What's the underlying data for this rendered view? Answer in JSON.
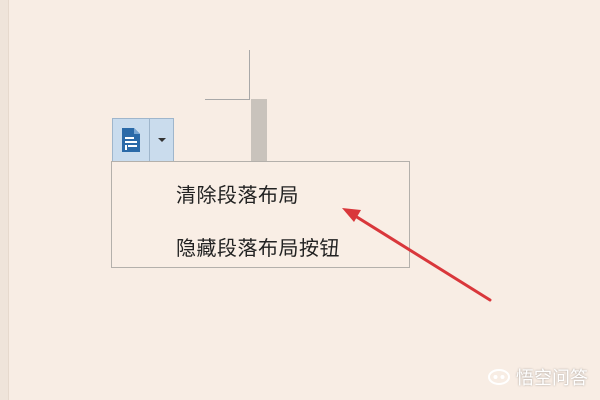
{
  "menu": {
    "items": [
      {
        "label": "清除段落布局"
      },
      {
        "label": "隐藏段落布局按钮"
      }
    ]
  },
  "icons": {
    "paragraph_layout_button": "paragraph-layout-icon",
    "dropdown": "chevron-down-icon",
    "annotation": "red-arrow"
  },
  "watermark": {
    "text": "悟空问答"
  },
  "colors": {
    "background": "#f8ede4",
    "button_blue": "#2b6aa8",
    "arrow_red": "#d9373b"
  }
}
